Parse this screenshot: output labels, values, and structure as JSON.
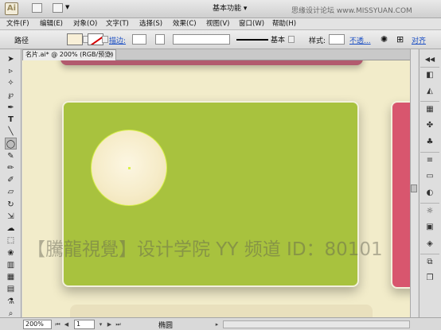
{
  "app": {
    "logo": "Ai",
    "workspace": "基本功能",
    "watermark_top": "思缘设计论坛  www.MISSYUAN.COM"
  },
  "menu": [
    "文件(F)",
    "编辑(E)",
    "对象(O)",
    "文字(T)",
    "选择(S)",
    "效果(C)",
    "视图(V)",
    "窗口(W)",
    "帮助(H)"
  ],
  "control": {
    "label": "路径",
    "stroke_link": "描边:",
    "brush_label": "基本",
    "style_label": "样式:",
    "opacity_link": "不透...",
    "align_link": "对齐"
  },
  "document": {
    "tab_title": "名片.ai* @ 200% (RGB/预览)",
    "tab_close": "×"
  },
  "canvas": {
    "watermark": "【騰龍視覺】设计学院  YY 频道 ID：80101"
  },
  "colors": {
    "canvas_bg": "#f2ecca",
    "card_green": "#a8c23e",
    "card_pink": "#d8566e",
    "circle_fill": "#f8efd7",
    "selection": "#d9f04a"
  },
  "status": {
    "zoom": "200%",
    "page": "1",
    "tool_name": "椭圆"
  },
  "tools": [
    "selection-icon",
    "direct-selection-icon",
    "magic-wand-icon",
    "lasso-icon",
    "pen-icon",
    "type-icon",
    "line-icon",
    "ellipse-icon",
    "paintbrush-icon",
    "pencil-icon",
    "blob-brush-icon",
    "eraser-icon",
    "rotate-icon",
    "scale-icon",
    "warp-icon",
    "free-transform-icon",
    "symbol-sprayer-icon",
    "graph-icon",
    "mesh-icon",
    "gradient-icon",
    "eyedropper-icon",
    "blend-icon",
    "artboard-icon",
    "slice-icon",
    "hand-icon",
    "zoom-icon"
  ]
}
